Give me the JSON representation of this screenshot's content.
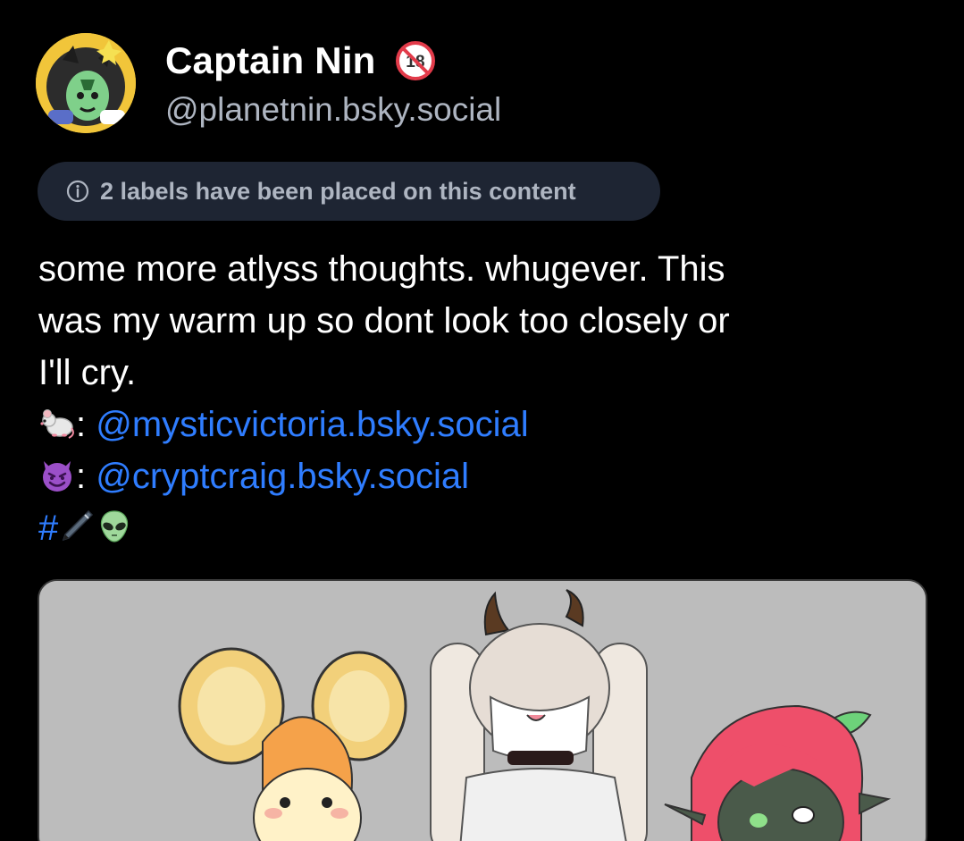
{
  "author": {
    "display_name": "Captain Nin",
    "handle": "@planetnin.bsky.social",
    "avatar_icon": "avatar-image",
    "badge_icon": "adult-content-18-icon"
  },
  "labels_notice": {
    "text": "2 labels have been placed on this content",
    "icon": "info-icon"
  },
  "post": {
    "line1": "some more atlyss thoughts. whugever. This",
    "line2": "was my warm up so dont look too closely or",
    "line3": "I'll cry.",
    "credit1": {
      "emoji": "mouse-emoji",
      "separator": ":",
      "mention": "@mysticvictoria.bsky.social"
    },
    "credit2": {
      "emoji": "smiling-devil-emoji",
      "separator": ":",
      "mention": "@cryptcraig.bsky.social"
    },
    "hashtag": {
      "prefix": "#",
      "emojis": [
        "pen-emoji",
        "alien-emoji"
      ]
    }
  },
  "media": {
    "description_icon": "character-artwork-image"
  },
  "colors": {
    "background": "#000000",
    "secondary_text": "#aeb5c1",
    "link": "#2f7dff",
    "pill_background": "#1e2533",
    "media_background": "#bcbcbc"
  }
}
